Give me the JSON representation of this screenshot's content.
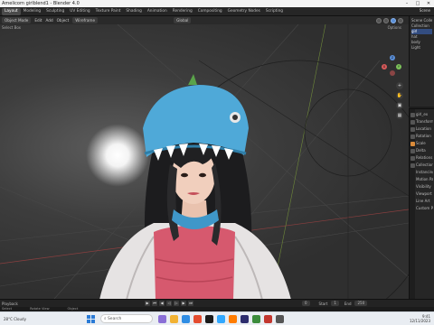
{
  "window": {
    "title": "Amelicorn girlblend1 - Blender 4.0",
    "controls": [
      "–",
      "□",
      "✕"
    ]
  },
  "workspaces": [
    "Layout",
    "Modeling",
    "Sculpting",
    "UV Editing",
    "Texture Paint",
    "Shading",
    "Animation",
    "Rendering",
    "Compositing",
    "Geometry Nodes",
    "Scripting"
  ],
  "active_workspace": "Layout",
  "header": {
    "menus": [
      "Object Mode",
      "Edit",
      "Add",
      "Object"
    ],
    "orientation": "Global",
    "pivot": "Wireframe",
    "select_box": "Select Box",
    "options": "Options",
    "scene": "Scene"
  },
  "outliner": {
    "items": [
      "Scene Collection",
      "Collection",
      "girl",
      "hat",
      "body",
      "Light"
    ]
  },
  "properties": {
    "rows": [
      "girl_ex",
      "Transform",
      "Location",
      "Rotation",
      "Scale",
      "Delta",
      "Relations",
      "Collections",
      "Instancing",
      "Motion Paths",
      "Visibility",
      "Viewport Display",
      "Line Art",
      "Custom Props"
    ]
  },
  "timeline": {
    "label": "Playback",
    "current_frame": "0",
    "start_label": "Start",
    "start": "1",
    "end_label": "End",
    "end": "250"
  },
  "status": {
    "left": "Select",
    "middle": "Rotate View",
    "right": "Object"
  },
  "taskbar": {
    "weather": "28°C Cloudy",
    "search_placeholder": "Search",
    "time": "9:41",
    "date": "12/11/2023"
  },
  "colors": {
    "accent": "#4a78c4",
    "viewport_bg": "#3d3d3d",
    "hat": "#4fa9d8",
    "shirt": "#d65a6e"
  }
}
